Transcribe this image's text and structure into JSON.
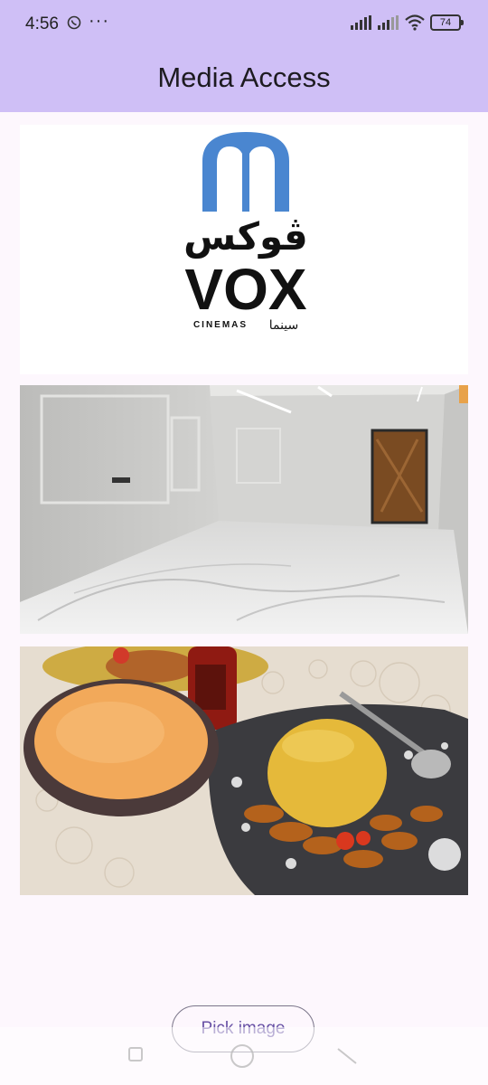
{
  "status_bar": {
    "time": "4:56",
    "dots": "···",
    "battery": "74",
    "icons": [
      "whatsapp-icon",
      "signal-icon",
      "signal-icon-2",
      "wifi-icon",
      "battery-icon"
    ]
  },
  "app_bar": {
    "title": "Media Access"
  },
  "images": [
    {
      "name": "vox-cinemas-logo",
      "arabic_top": "ڤوكس",
      "brand": "VOX",
      "sub_latin": "CINEMAS",
      "sub_arabic": "سينما"
    },
    {
      "name": "marble-room-photo"
    },
    {
      "name": "food-plate-photo"
    }
  ],
  "actions": {
    "pick_image": "Pick image"
  },
  "colors": {
    "app_bar": "#cfbff6",
    "background": "#fdf7fd",
    "accent": "#6750a4",
    "vox_blue": "#4a86d0"
  }
}
